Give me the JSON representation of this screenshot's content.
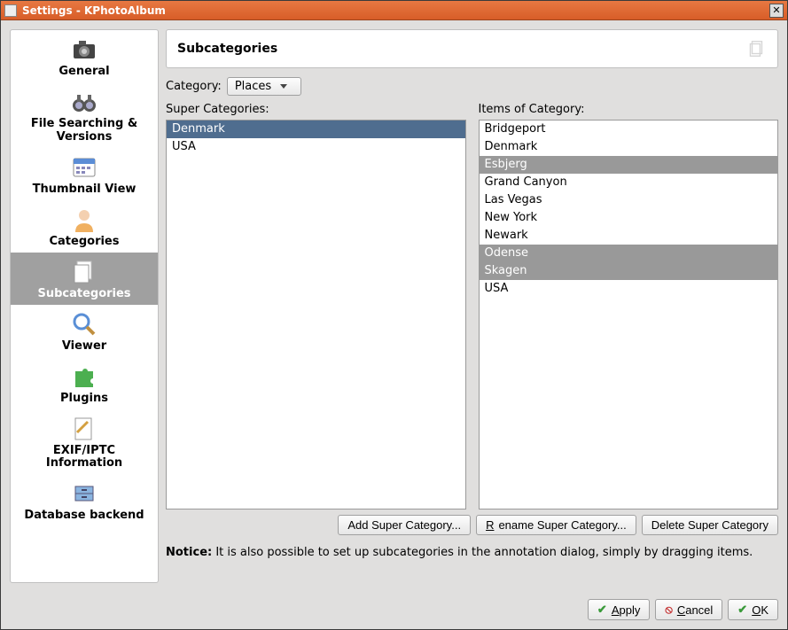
{
  "window": {
    "title": "Settings - KPhotoAlbum"
  },
  "sidebar": {
    "items": [
      {
        "label": "General"
      },
      {
        "label": "File Searching & Versions"
      },
      {
        "label": "Thumbnail View"
      },
      {
        "label": "Categories"
      },
      {
        "label": "Subcategories"
      },
      {
        "label": "Viewer"
      },
      {
        "label": "Plugins"
      },
      {
        "label": "EXIF/IPTC Information"
      },
      {
        "label": "Database backend"
      }
    ]
  },
  "page": {
    "title": "Subcategories",
    "category_label": "Category:",
    "category_value": "Places",
    "super_label": "Super Categories:",
    "items_label": "Items of Category:",
    "super_list": [
      "Denmark",
      "USA"
    ],
    "items_list": [
      "Bridgeport",
      "Denmark",
      "Esbjerg",
      "Grand Canyon",
      "Las Vegas",
      "New York",
      "Newark",
      "Odense",
      "Skagen",
      "USA"
    ],
    "add_btn": "Add Super Category...",
    "rename_btn": "Rename Super Category...",
    "delete_btn": "Delete Super Category",
    "notice_label": "Notice:",
    "notice_text": " It is also possible to set up subcategories in the annotation dialog, simply by dragging items."
  },
  "footer": {
    "apply": "Apply",
    "cancel": "Cancel",
    "ok": "OK"
  }
}
